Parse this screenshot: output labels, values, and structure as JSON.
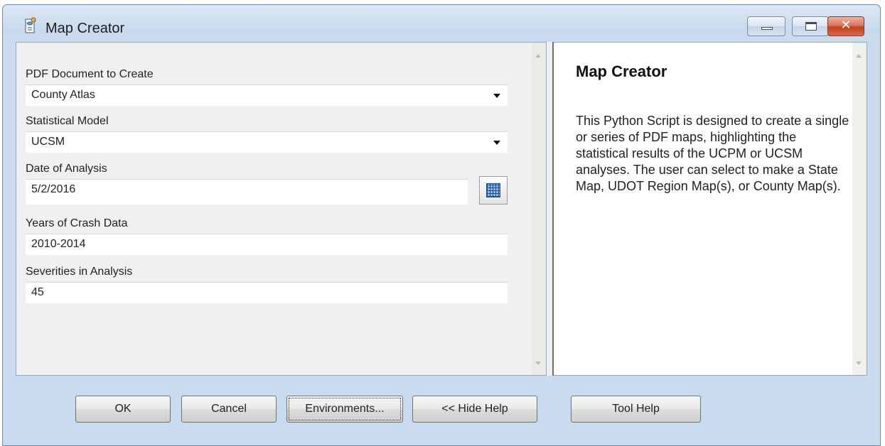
{
  "window": {
    "title": "Map Creator",
    "close_glyph": "✕"
  },
  "form": {
    "fields": [
      {
        "label": "PDF Document to Create",
        "value": "County Atlas",
        "type": "dropdown"
      },
      {
        "label": "Statistical Model",
        "value": "UCSM",
        "type": "dropdown"
      },
      {
        "label": "Date of Analysis",
        "value": "5/2/2016",
        "type": "date"
      },
      {
        "label": "Years of Crash Data",
        "value": "2010-2014",
        "type": "text"
      },
      {
        "label": "Severities in Analysis",
        "value": "45",
        "type": "text"
      }
    ]
  },
  "help": {
    "title": "Map Creator",
    "body": "This Python Script is designed to create a single or series of PDF maps, highlighting the statistical results of the UCPM or UCSM analyses. The user can select to make a State Map, UDOT Region Map(s), or County Map(s)."
  },
  "buttons": {
    "ok": "OK",
    "cancel": "Cancel",
    "environments": "Environments...",
    "hide_help": "<< Hide Help",
    "tool_help": "Tool Help"
  },
  "icons": {
    "app": "toolbox-script-icon",
    "calendar": "calendar-icon",
    "dropdown": "chevron-down-icon"
  },
  "colors": {
    "title_bar": "#c6d8ec",
    "close_button": "#c43f1f",
    "calendar_accent": "#1f4f88"
  }
}
